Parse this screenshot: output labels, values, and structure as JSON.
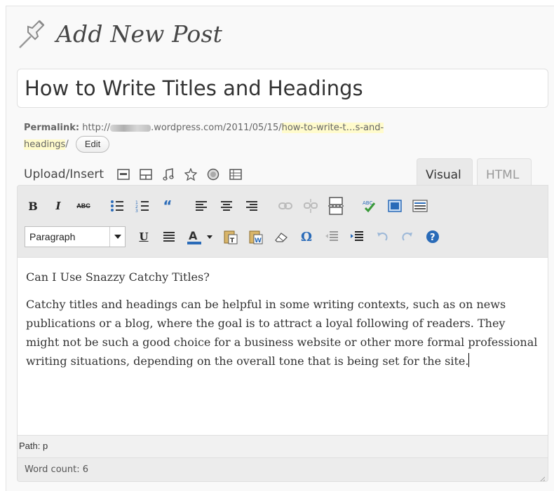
{
  "header": {
    "title": "Add New Post",
    "icon": "pushpin-icon"
  },
  "post": {
    "title": "How to Write Titles and Headings"
  },
  "permalink": {
    "label": "Permalink:",
    "url_prefix": "http://",
    "url_domain": ".wordpress.com/2011/05/15/",
    "slug_part1": "how-to-write-t…s-and-",
    "slug_part2": "headings",
    "url_suffix": "/",
    "edit_label": "Edit"
  },
  "media": {
    "label": "Upload/Insert",
    "icons": [
      "image-icon",
      "gallery-icon",
      "music-icon",
      "media-icon",
      "video-icon",
      "list-icon"
    ]
  },
  "tabs": {
    "visual": "Visual",
    "html": "HTML"
  },
  "toolbar": {
    "row1": [
      "bold-icon",
      "italic-icon",
      "strikethrough-icon",
      "bullet-list-icon",
      "numbered-list-icon",
      "blockquote-icon",
      "align-left-icon",
      "align-center-icon",
      "align-right-icon",
      "link-icon",
      "unlink-icon",
      "more-tag-icon",
      "spellcheck-icon",
      "fullscreen-icon",
      "kitchen-sink-icon"
    ],
    "format_value": "Paragraph",
    "row2": [
      "underline-icon",
      "justify-icon",
      "text-color-icon",
      "paste-text-icon",
      "paste-word-icon",
      "clear-format-icon",
      "special-char-icon",
      "outdent-icon",
      "indent-icon",
      "undo-icon",
      "redo-icon",
      "help-icon"
    ]
  },
  "content": {
    "heading": "Can I Use Snazzy Catchy Titles?",
    "paragraph": "Catchy titles and headings can be helpful in some writing contexts, such as on news publications or a blog, where the goal is to attract a loyal following of readers. They might not be such a good choice for a business website or other more formal professional writing situations, depending on the overall tone that is being set for the site."
  },
  "status": {
    "path": "Path: p",
    "word_count": "Word count: 6"
  },
  "colors": {
    "slug_highlight": "#fffbcc",
    "toolbar_bg": "#e9e9e9",
    "title_color": "#464646"
  }
}
